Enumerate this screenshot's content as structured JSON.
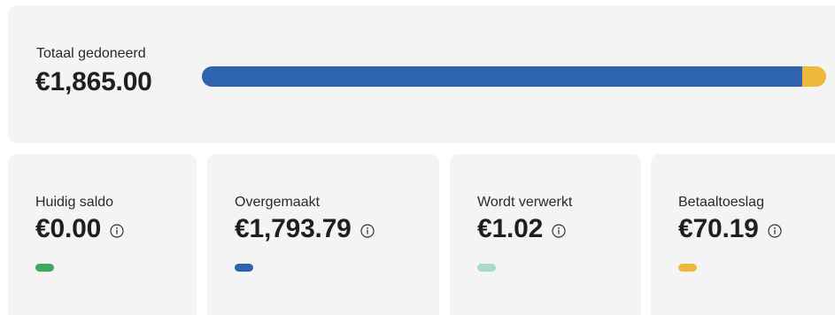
{
  "summary": {
    "total_label": "Totaal gedoneerd",
    "total_amount": "€1,865.00",
    "bar_segments": [
      {
        "name": "Huidig saldo",
        "fraction": 0.0,
        "color": "#3daa5c"
      },
      {
        "name": "Overgemaakt",
        "fraction": 0.9619,
        "color": "#2e63ad"
      },
      {
        "name": "Wordt verwerkt",
        "fraction": 0.0005,
        "color": "#a6dcc7"
      },
      {
        "name": "Betaaltoeslag",
        "fraction": 0.0376,
        "color": "#f0b83a"
      }
    ]
  },
  "cards": [
    {
      "label": "Huidig saldo",
      "amount": "€0.00",
      "color": "#3daa5c",
      "icon": "info-icon"
    },
    {
      "label": "Overgemaakt",
      "amount": "€1,793.79",
      "color": "#2e63ad",
      "icon": "info-icon"
    },
    {
      "label": "Wordt verwerkt",
      "amount": "€1.02",
      "color": "#a6dcc7",
      "icon": "info-icon"
    },
    {
      "label": "Betaaltoeslag",
      "amount": "€70.19",
      "color": "#f0b83a",
      "icon": "info-icon"
    }
  ]
}
